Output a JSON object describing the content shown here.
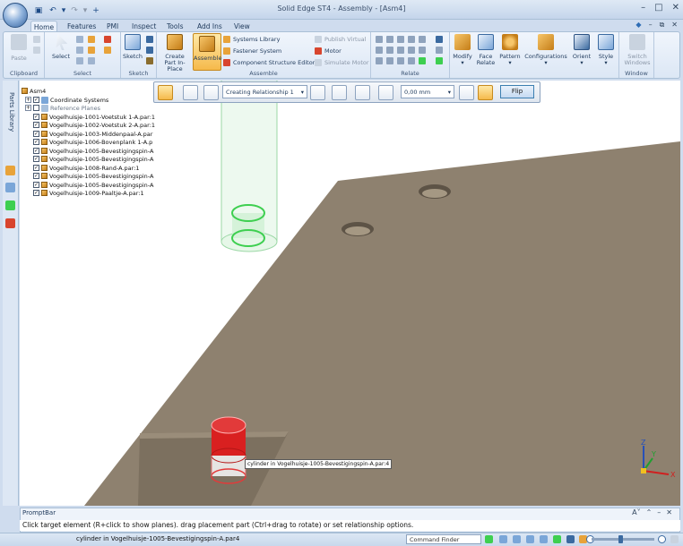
{
  "app_title": "Solid Edge ST4 - Assembly - [Asm4]",
  "qat_plus": "+",
  "tabs": [
    "Home",
    "Features",
    "PMI",
    "Inspect",
    "Tools",
    "Add Ins",
    "View"
  ],
  "ribbon": {
    "clipboard": {
      "label": "Clipboard",
      "paste": "Paste"
    },
    "select": {
      "label": "Select",
      "select": "Select"
    },
    "sketch": {
      "label": "Sketch",
      "sketch": "Sketch"
    },
    "assemble": {
      "label": "Assemble",
      "create_part": "Create Part In-Place",
      "assemble": "Assemble",
      "systems_library": "Systems Library",
      "fastener_system": "Fastener System",
      "component_structure_editor": "Component Structure Editor",
      "publish_virtual": "Publish Virtual",
      "motor": "Motor",
      "simulate_motor": "Simulate Motor"
    },
    "relate": {
      "label": "Relate"
    },
    "modify": {
      "modify": "Modify",
      "face_relate": "Face Relate",
      "pattern": "Pattern",
      "configurations": "Configurations",
      "orient": "Orient",
      "style": "Style"
    },
    "window": {
      "label": "Window",
      "switch_windows": "Switch Windows"
    }
  },
  "left_strip": {
    "parts_library": "Parts Library"
  },
  "tree": [
    {
      "label": "Asm4",
      "type": "assembly"
    },
    {
      "label": "Coordinate Systems",
      "type": "coord",
      "checked": true
    },
    {
      "label": "Reference Planes",
      "type": "planes",
      "checked": false
    },
    {
      "label": "Vogelhuisje-1001-Voetstuk 1-A.par:1",
      "type": "part",
      "checked": true
    },
    {
      "label": "Vogelhuisje-1002-Voetstuk 2-A.par:1",
      "type": "part",
      "checked": true
    },
    {
      "label": "Vogelhuisje-1003-Middenpaal-A.par",
      "type": "part",
      "checked": true
    },
    {
      "label": "Vogelhuisje-1006-Bovenplank 1-A.p",
      "type": "part",
      "checked": true
    },
    {
      "label": "Vogelhuisje-1005-Bevestigingspin-A",
      "type": "part",
      "checked": true
    },
    {
      "label": "Vogelhuisje-1005-Bevestigingspin-A",
      "type": "part",
      "checked": true
    },
    {
      "label": "Vogelhuisje-1008-Rand-A.par:1",
      "type": "part",
      "checked": true
    },
    {
      "label": "Vogelhuisje-1005-Bevestigingspin-A",
      "type": "part",
      "checked": true
    },
    {
      "label": "Vogelhuisje-1005-Bevestigingspin-A",
      "type": "part",
      "checked": true
    },
    {
      "label": "Vogelhuisje-1009-Paaltje-A.par:1",
      "type": "part",
      "checked": true
    }
  ],
  "command_bar": {
    "relationship": "Creating Relationship 1",
    "offset": "0,00 mm",
    "flip": "Flip"
  },
  "viewport": {
    "tooltip": "cylinder in Vogelhuisje-1005-Bevestigingspin-A.par:4",
    "axis_z": "Z",
    "axis_y": "Y",
    "axis_x": "X"
  },
  "promptbar": {
    "title": "PromptBar",
    "message": "Click target element (R+click to show planes). drag placement part (Ctrl+drag to rotate) or set relationship options."
  },
  "statusbar": {
    "text": "cylinder in Vogelhuisje-1005-Bevestigingspin-A.par4",
    "command_finder": "Command Finder"
  },
  "colors": {
    "accent": "#f0a830",
    "selected_part": "#d92020",
    "highlight": "#3ecf50",
    "plate": "#8e816f",
    "plate_side": "#6f6454"
  }
}
